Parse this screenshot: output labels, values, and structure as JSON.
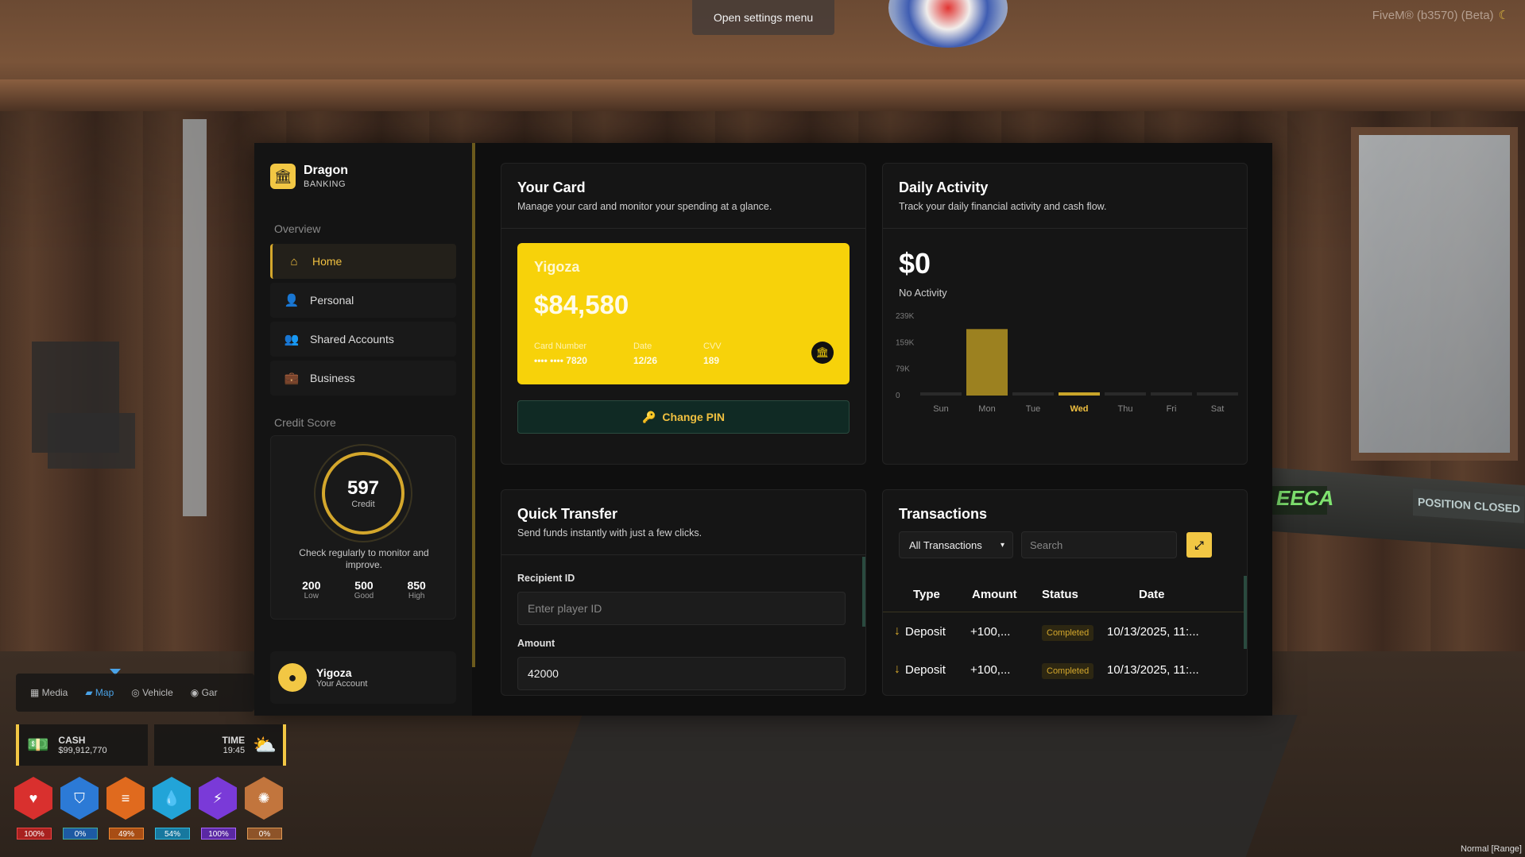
{
  "topbar": {
    "settings_label": "Open settings menu",
    "client_version": "FiveM® (b3570) (Beta)",
    "mode_label": "Normal [Range]"
  },
  "sidebar": {
    "brand_name": "Dragon",
    "brand_sub": "BANKING",
    "overview_label": "Overview",
    "nav": [
      {
        "label": "Home",
        "icon": "home-icon",
        "active": true
      },
      {
        "label": "Personal",
        "icon": "user-icon",
        "active": false
      },
      {
        "label": "Shared Accounts",
        "icon": "users-icon",
        "active": false
      },
      {
        "label": "Business",
        "icon": "briefcase-icon",
        "active": false
      }
    ],
    "credit_label": "Credit Score",
    "credit": {
      "score": "597",
      "score_label": "Credit",
      "description": "Check regularly to monitor and improve.",
      "ranges": [
        {
          "value": "200",
          "label": "Low"
        },
        {
          "value": "500",
          "label": "Good"
        },
        {
          "value": "850",
          "label": "High"
        }
      ]
    },
    "account": {
      "name": "Yigoza",
      "sub": "Your Account"
    }
  },
  "your_card": {
    "title": "Your Card",
    "subtitle": "Manage your card and monitor your spending at a glance.",
    "holder": "Yigoza",
    "balance": "$84,580",
    "number_label": "Card Number",
    "number_value": "•••• •••• 7820",
    "date_label": "Date",
    "date_value": "12/26",
    "cvv_label": "CVV",
    "cvv_value": "189",
    "change_pin": "Change PIN",
    "accent_color": "#f7d20a"
  },
  "daily_activity": {
    "title": "Daily Activity",
    "subtitle": "Track your daily financial activity and cash flow.",
    "amount": "$0",
    "status": "No Activity"
  },
  "chart_data": {
    "type": "bar",
    "categories": [
      "Sun",
      "Mon",
      "Tue",
      "Wed",
      "Thu",
      "Fri",
      "Sat"
    ],
    "values": [
      0,
      200000,
      0,
      0,
      0,
      0,
      0
    ],
    "highlight": "Wed",
    "yticks": [
      "239K",
      "159K",
      "79K",
      "0"
    ],
    "ylim": [
      0,
      239000
    ],
    "bar_color": "#9c8120",
    "grid": false
  },
  "quick_transfer": {
    "title": "Quick Transfer",
    "subtitle": "Send funds instantly with just a few clicks.",
    "recipient_label": "Recipient ID",
    "recipient_placeholder": "Enter player ID",
    "amount_label": "Amount",
    "amount_value": "42000"
  },
  "transactions": {
    "title": "Transactions",
    "filter_value": "All Transactions",
    "search_placeholder": "Search",
    "columns": [
      "Type",
      "Amount",
      "Status",
      "Date"
    ],
    "rows": [
      {
        "type": "Deposit",
        "amount": "+100,...",
        "status": "Completed",
        "date": "10/13/2025, 11:..."
      },
      {
        "type": "Deposit",
        "amount": "+100,...",
        "status": "Completed",
        "date": "10/13/2025, 11:..."
      }
    ]
  },
  "hud": {
    "tabs": [
      {
        "label": "Media",
        "active": false
      },
      {
        "label": "Map",
        "active": true
      },
      {
        "label": "Vehicle",
        "active": false
      },
      {
        "label": "Gar",
        "active": false
      }
    ],
    "cash_label": "CASH",
    "cash_value": "$99,912,770",
    "time_label": "TIME",
    "time_value": "19:45",
    "stats": [
      {
        "icon": "heart-icon",
        "value": "100%",
        "color": "#d9302e"
      },
      {
        "icon": "shield-icon",
        "value": "0%",
        "color": "#2c7ad6"
      },
      {
        "icon": "burger-icon",
        "value": "49%",
        "color": "#e06a1e"
      },
      {
        "icon": "water-drop-icon",
        "value": "54%",
        "color": "#22a4d8"
      },
      {
        "icon": "lightning-icon",
        "value": "100%",
        "color": "#7a3ad8"
      },
      {
        "icon": "brain-icon",
        "value": "0%",
        "color": "#c2753d"
      }
    ]
  }
}
